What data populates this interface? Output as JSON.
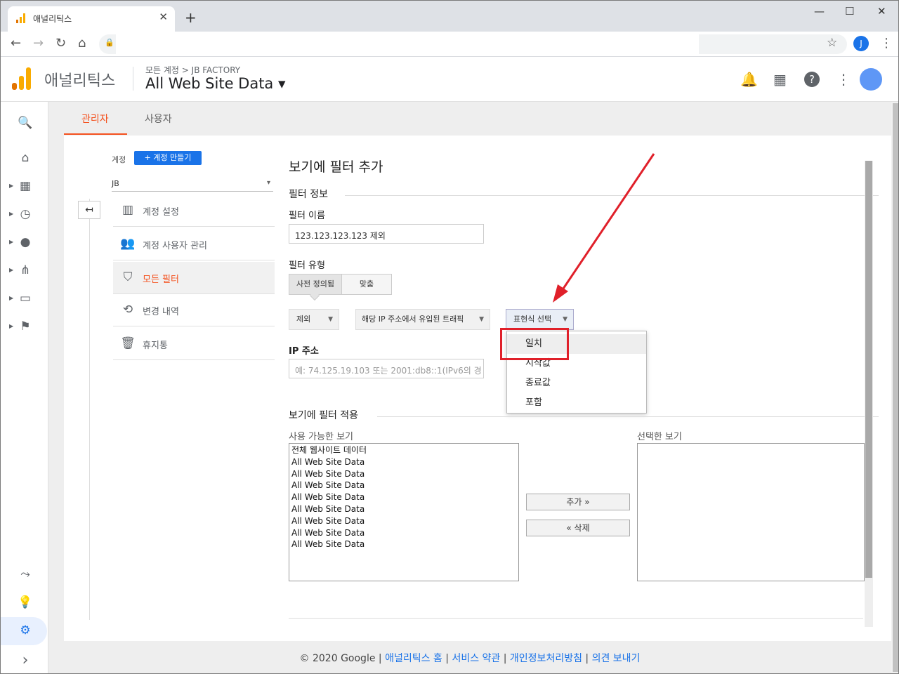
{
  "browser": {
    "tab_title": "애널리틱스",
    "close_glyph": "✕",
    "newtab_glyph": "+",
    "window_controls": [
      "—",
      "☐",
      "✕"
    ],
    "nav": {
      "back": "←",
      "forward": "→",
      "reload": "↻",
      "home": "⌂",
      "lock": "🔒",
      "star": "☆",
      "menu": "⋮"
    },
    "profile_initial": "J"
  },
  "header": {
    "brand": "애널리틱스",
    "breadcrumb": "모든 계정 > JB FACTORY",
    "view_name": "All Web Site Data ▾",
    "icons": [
      "🔔",
      "▦",
      "?",
      "⋮"
    ]
  },
  "rail": {
    "icons": [
      "🔍",
      "⌂",
      "▦",
      "◷",
      "●",
      "⋔",
      "▭",
      "⚑",
      "⤳",
      "💡",
      "⚙",
      "›"
    ]
  },
  "admin_tabs": {
    "admin": "관리자",
    "user": "사용자"
  },
  "account": {
    "label": "계정",
    "create_button": "+ 계정 만들기",
    "selected": "JB",
    "dropdown_glyph": "▾",
    "back_glyph": "↤"
  },
  "menu": [
    {
      "icon": "▥",
      "label": "계정 설정"
    },
    {
      "icon": "👥",
      "label": "계정 사용자 관리"
    },
    {
      "icon": "⛉",
      "label": "모든 필터"
    },
    {
      "icon": "⟲",
      "label": "변경 내역"
    },
    {
      "icon": "🗑",
      "label": "휴지통"
    }
  ],
  "form": {
    "title": "보기에 필터 추가",
    "section_info": "필터 정보",
    "filter_name_label": "필터 이름",
    "filter_name_value": "123.123.123.123 제외",
    "filter_type_label": "필터 유형",
    "seg_predefined": "사전 정의됨",
    "seg_custom": "맞춤",
    "dd_exclude": "제외",
    "dd_traffic": "해당 IP 주소에서 유입된 트래픽",
    "dd_expression": "표현식 선택",
    "dd_arrow": "▼",
    "expression_options": [
      "일치",
      "시작값",
      "종료값",
      "포함"
    ],
    "ip_label": "IP 주소",
    "ip_placeholder": "예: 74.125.19.103 또는 2001:db8::1(IPv6의 경",
    "section_apply": "보기에 필터 적용",
    "available_label": "사용 가능한 보기",
    "selected_label": "선택한 보기",
    "available_views": [
      "전체 웹사이트 데이터",
      "All Web Site Data",
      "All Web Site Data",
      "All Web Site Data",
      "All Web Site Data",
      "All Web Site Data",
      "All Web Site Data",
      "All Web Site Data",
      "All Web Site Data"
    ],
    "add_button": "추가 »",
    "remove_button": "« 삭제"
  },
  "footer": {
    "copyright": "© 2020 Google",
    "links": [
      "애널리틱스 홈",
      "서비스 약관",
      "개인정보처리방침",
      "의견 보내기"
    ],
    "sep": " | "
  },
  "colors": {
    "accent": "#f4511e",
    "primary": "#1a73e8",
    "annotation": "#e0202a"
  }
}
